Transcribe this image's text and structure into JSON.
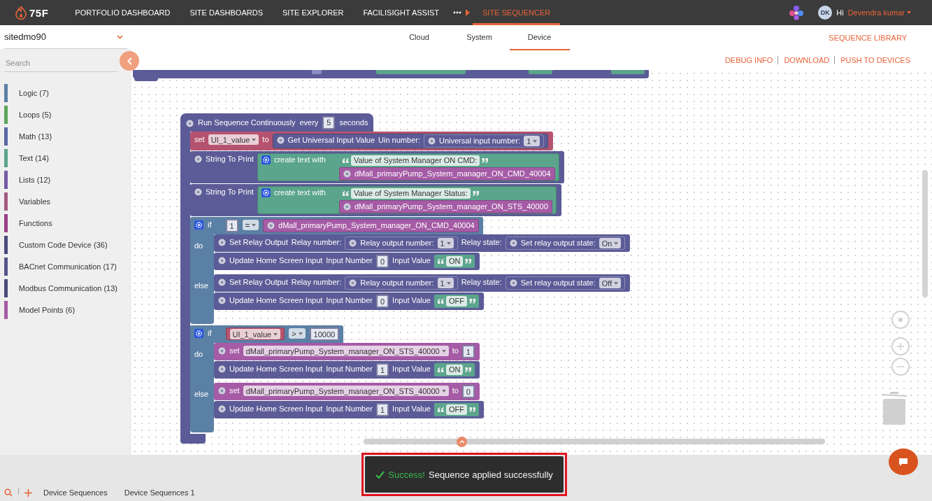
{
  "header": {
    "logo": "75F",
    "nav": [
      {
        "label": "PORTFOLIO DASHBOARD",
        "selected": false
      },
      {
        "label": "SITE DASHBOARDS",
        "selected": false
      },
      {
        "label": "SITE EXPLORER",
        "selected": false
      },
      {
        "label": "FACILISIGHT ASSIST",
        "selected": false
      },
      {
        "label": "SITE SEQUENCER",
        "selected": true
      }
    ],
    "user": {
      "avatar": "DK",
      "greeting": "Hi",
      "name": "Devendra kumar"
    }
  },
  "site_select": {
    "value": "sitedmo90"
  },
  "tabs": [
    {
      "label": "Cloud",
      "selected": false
    },
    {
      "label": "System",
      "selected": false
    },
    {
      "label": "Device",
      "selected": true
    }
  ],
  "sequence_library": "SEQUENCE LIBRARY",
  "actions": [
    "DEBUG INFO",
    "DOWNLOAD",
    "PUSH TO DEVICES"
  ],
  "palette": {
    "search": {
      "placeholder": "Search"
    },
    "categories": [
      {
        "label": "Logic (7)",
        "color": "#5b80a5"
      },
      {
        "label": "Loops (5)",
        "color": "#5ba55b"
      },
      {
        "label": "Math (13)",
        "color": "#5b67a5"
      },
      {
        "label": "Text (14)",
        "color": "#5ba58c"
      },
      {
        "label": "Lists (12)",
        "color": "#745ba5"
      },
      {
        "label": "Variables",
        "color": "#a55b80"
      },
      {
        "label": "Functions",
        "color": "#9a3f86"
      },
      {
        "label": "Custom Code Device (36)",
        "color": "#4b4b7d"
      },
      {
        "label": "BACnet Communication (17)",
        "color": "#55558a"
      },
      {
        "label": "Modbus Communication (13)",
        "color": "#4a4a78"
      },
      {
        "label": "Model Points (6)",
        "color": "#a55ba5"
      }
    ]
  },
  "workspace": {
    "sequence": {
      "color": "#5b5b97",
      "header": [
        {
          "kind": "text",
          "text": "Run Sequence Continuously"
        },
        {
          "kind": "text",
          "text": "every"
        },
        {
          "kind": "number",
          "text": "5"
        },
        {
          "kind": "text",
          "text": "seconds"
        }
      ],
      "body": [
        {
          "kind": "set_variable",
          "color": "#b5536f",
          "parts": [
            {
              "kind": "text",
              "text": "set"
            },
            {
              "kind": "dropdown",
              "text": "UI_1_value"
            },
            {
              "kind": "text",
              "text": "to"
            },
            {
              "kind": "reporter",
              "color": "#5b5b97",
              "parts": [
                {
                  "kind": "text",
                  "text": "Get Universal Input Value"
                },
                {
                  "kind": "text",
                  "text": "Uin number:"
                },
                {
                  "kind": "input_block",
                  "parts": [
                    {
                      "kind": "text",
                      "text": "Universal input number:"
                    },
                    {
                      "kind": "dropdown",
                      "text": "1"
                    }
                  ]
                }
              ]
            }
          ]
        },
        {
          "kind": "statement",
          "color": "#5b5b97",
          "parts": [
            {
              "kind": "text",
              "text": "String To Print"
            },
            {
              "kind": "join",
              "color": "#5ba58c",
              "parts": [
                {
                  "kind": "text",
                  "text": "create text with"
                }
              ],
              "inputs": [
                [
                  {
                    "kind": "quote",
                    "text": "Value of System Manager ON CMD:"
                  }
                ],
                [
                  {
                    "kind": "reporter",
                    "color": "#a55ba5",
                    "parts": [
                      {
                        "kind": "text",
                        "text": "dMall_primaryPump_System_manager_ON_CMD_40004"
                      }
                    ]
                  }
                ]
              ]
            }
          ]
        },
        {
          "kind": "statement",
          "color": "#5b5b97",
          "parts": [
            {
              "kind": "text",
              "text": "String To Print"
            },
            {
              "kind": "join",
              "color": "#5ba58c",
              "parts": [
                {
                  "kind": "text",
                  "text": "create text with"
                }
              ],
              "inputs": [
                [
                  {
                    "kind": "quote",
                    "text": "Value of System Manager Status:"
                  }
                ],
                [
                  {
                    "kind": "reporter",
                    "color": "#a55ba5",
                    "parts": [
                      {
                        "kind": "text",
                        "text": "dMall_primaryPump_System_manager_ON_STS_40000"
                      }
                    ]
                  }
                ]
              ]
            }
          ]
        },
        {
          "kind": "if",
          "color": "#5b80a5",
          "label": "if",
          "condition": [
            {
              "kind": "number",
              "text": "1"
            },
            {
              "kind": "dropdown",
              "text": "="
            },
            {
              "kind": "reporter",
              "color": "#a55ba5",
              "parts": [
                {
                  "kind": "text",
                  "text": "dMall_primaryPump_System_manager_ON_CMD_40004"
                }
              ]
            }
          ],
          "branches": [
            {
              "label": "do",
              "statements": [
                {
                  "kind": "statement",
                  "color": "#5b5b97",
                  "parts": [
                    {
                      "kind": "text",
                      "text": "Set Relay Output"
                    },
                    {
                      "kind": "text",
                      "text": "Relay number:"
                    },
                    {
                      "kind": "input_block",
                      "parts": [
                        {
                          "kind": "text",
                          "text": "Relay output number:"
                        },
                        {
                          "kind": "dropdown",
                          "text": "1"
                        }
                      ]
                    },
                    {
                      "kind": "text",
                      "text": "Relay state:"
                    },
                    {
                      "kind": "input_block",
                      "parts": [
                        {
                          "kind": "text",
                          "text": "Set relay output state:"
                        },
                        {
                          "kind": "dropdown",
                          "text": "On"
                        }
                      ]
                    }
                  ]
                },
                {
                  "kind": "statement",
                  "color": "#5b5b97",
                  "parts": [
                    {
                      "kind": "text",
                      "text": "Update Home Screen Input"
                    },
                    {
                      "kind": "text",
                      "text": "Input Number"
                    },
                    {
                      "kind": "number",
                      "text": "0"
                    },
                    {
                      "kind": "text",
                      "text": "Input Value"
                    },
                    {
                      "kind": "text_block",
                      "text": "ON"
                    }
                  ]
                }
              ]
            },
            {
              "label": "else",
              "statements": [
                {
                  "kind": "statement",
                  "color": "#5b5b97",
                  "parts": [
                    {
                      "kind": "text",
                      "text": "Set Relay Output"
                    },
                    {
                      "kind": "text",
                      "text": "Relay number:"
                    },
                    {
                      "kind": "input_block",
                      "parts": [
                        {
                          "kind": "text",
                          "text": "Relay output number:"
                        },
                        {
                          "kind": "dropdown",
                          "text": "1"
                        }
                      ]
                    },
                    {
                      "kind": "text",
                      "text": "Relay state:"
                    },
                    {
                      "kind": "input_block",
                      "parts": [
                        {
                          "kind": "text",
                          "text": "Set relay output state:"
                        },
                        {
                          "kind": "dropdown",
                          "text": "Off"
                        }
                      ]
                    }
                  ]
                },
                {
                  "kind": "statement",
                  "color": "#5b5b97",
                  "parts": [
                    {
                      "kind": "text",
                      "text": "Update Home Screen Input"
                    },
                    {
                      "kind": "text",
                      "text": "Input Number"
                    },
                    {
                      "kind": "number",
                      "text": "0"
                    },
                    {
                      "kind": "text",
                      "text": "Input Value"
                    },
                    {
                      "kind": "text_block",
                      "text": "OFF"
                    }
                  ]
                }
              ]
            }
          ]
        },
        {
          "kind": "if",
          "color": "#5b80a5",
          "label": "if",
          "condition": [
            {
              "kind": "variable",
              "color": "#b5536f",
              "parts": [
                {
                  "kind": "dropdown",
                  "text": "UI_1_value"
                }
              ]
            },
            {
              "kind": "dropdown",
              "text": ">"
            },
            {
              "kind": "number",
              "text": "10000"
            }
          ],
          "branches": [
            {
              "label": "do",
              "statements": [
                {
                  "kind": "statement",
                  "color": "#a55ba5",
                  "parts": [
                    {
                      "kind": "text",
                      "text": "set"
                    },
                    {
                      "kind": "dropdown",
                      "text": "dMall_primaryPump_System_manager_ON_STS_40000"
                    },
                    {
                      "kind": "text",
                      "text": "to"
                    },
                    {
                      "kind": "number",
                      "text": "1"
                    }
                  ]
                },
                {
                  "kind": "statement",
                  "color": "#5b5b97",
                  "parts": [
                    {
                      "kind": "text",
                      "text": "Update Home Screen Input"
                    },
                    {
                      "kind": "text",
                      "text": "Input Number"
                    },
                    {
                      "kind": "number",
                      "text": "1"
                    },
                    {
                      "kind": "text",
                      "text": "Input Value"
                    },
                    {
                      "kind": "text_block",
                      "text": "ON"
                    }
                  ]
                }
              ]
            },
            {
              "label": "else",
              "statements": [
                {
                  "kind": "statement",
                  "color": "#a55ba5",
                  "parts": [
                    {
                      "kind": "text",
                      "text": "set"
                    },
                    {
                      "kind": "dropdown",
                      "text": "dMall_primaryPump_System_manager_ON_STS_40000"
                    },
                    {
                      "kind": "text",
                      "text": "to"
                    },
                    {
                      "kind": "number",
                      "text": "0"
                    }
                  ]
                },
                {
                  "kind": "statement",
                  "color": "#5b5b97",
                  "parts": [
                    {
                      "kind": "text",
                      "text": "Update Home Screen Input"
                    },
                    {
                      "kind": "text",
                      "text": "Input Number"
                    },
                    {
                      "kind": "number",
                      "text": "1"
                    },
                    {
                      "kind": "text",
                      "text": "Input Value"
                    },
                    {
                      "kind": "text_block",
                      "text": "OFF"
                    }
                  ]
                }
              ]
            }
          ]
        }
      ]
    }
  },
  "bottom_bar": {
    "tabs": [
      "Device Sequences",
      "Device Sequences 1"
    ]
  },
  "toast": {
    "title": "Success!",
    "message": "Sequence applied successfully"
  }
}
